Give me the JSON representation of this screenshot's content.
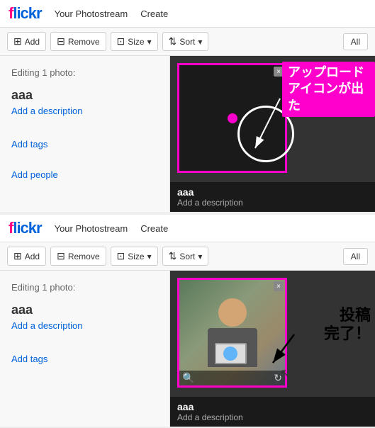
{
  "navbar": {
    "logo": "flickr",
    "logo_f": "f",
    "logo_licr": "licr",
    "links": [
      "Your Photostream",
      "Create"
    ]
  },
  "toolbar": {
    "add_label": "Add",
    "remove_label": "Remove",
    "size_label": "Size",
    "sort_label": "Sort",
    "all_label": "All"
  },
  "section1": {
    "editing_label": "Editing 1 photo:",
    "photo_title": "aaa",
    "add_description": "Add a description",
    "add_tags": "Add tags",
    "add_people": "Add people",
    "caption_title": "aaa",
    "caption_desc": "Add a description",
    "annotation_text_line1": "アップロード",
    "annotation_text_line2": "アイコンが出た",
    "close_x": "×"
  },
  "section2": {
    "editing_label": "Editing 1 photo:",
    "photo_title": "aaa",
    "add_description": "Add a description",
    "add_tags": "Add tags",
    "caption_title": "aaa",
    "caption_desc": "Add a description",
    "annotation_text": "投稿\n完了！",
    "close_x": "×"
  }
}
